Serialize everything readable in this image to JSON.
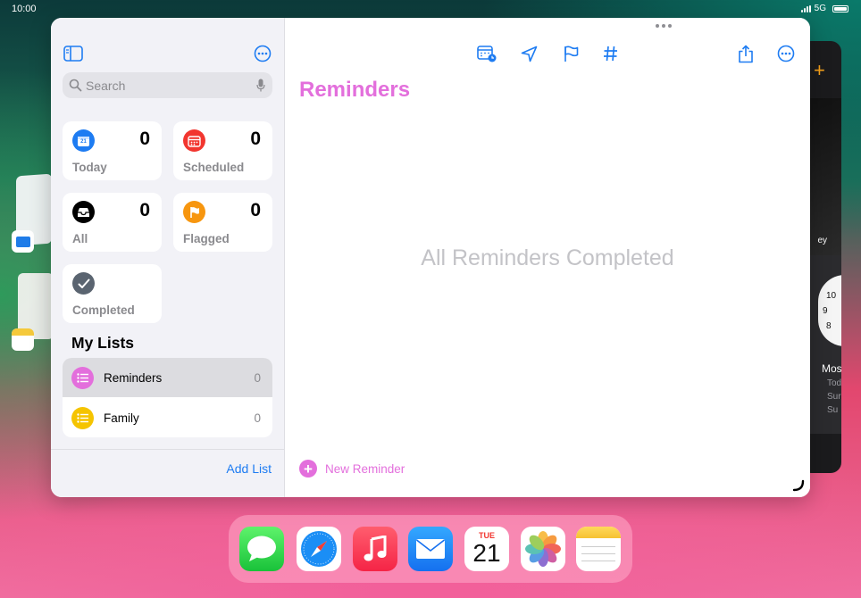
{
  "status_bar": {
    "time": "10:00",
    "network": "5G"
  },
  "sidebar": {
    "search": {
      "placeholder": "Search"
    },
    "smart_lists": [
      {
        "label": "Today",
        "count": "0",
        "color": "#1e7cf2",
        "icon": "calendar-today-icon",
        "day": "21"
      },
      {
        "label": "Scheduled",
        "count": "0",
        "color": "#f2362f",
        "icon": "calendar-icon"
      },
      {
        "label": "All",
        "count": "0",
        "color": "#000000",
        "icon": "tray-icon"
      },
      {
        "label": "Flagged",
        "count": "0",
        "color": "#f7960f",
        "icon": "flag-icon"
      },
      {
        "label": "Completed",
        "count": "",
        "color": "#5a6470",
        "icon": "checkmark-icon"
      }
    ],
    "my_lists_title": "My Lists",
    "lists": [
      {
        "name": "Reminders",
        "count": "0",
        "color": "#e36fdc",
        "selected": true
      },
      {
        "name": "Family",
        "count": "0",
        "color": "#f5c400",
        "selected": false
      }
    ],
    "add_list_label": "Add List"
  },
  "main": {
    "title": "Reminders",
    "title_color": "#e36fdc",
    "empty_message": "All Reminders Completed",
    "new_reminder_label": "New Reminder"
  },
  "dock": {
    "apps": [
      "messages",
      "safari",
      "music",
      "mail",
      "calendar",
      "photos",
      "notes"
    ],
    "calendar_dow": "TUE",
    "calendar_day": "21"
  },
  "background_app": {
    "label_fragment": "ey",
    "clock_numbers": [
      "10",
      "9",
      "8"
    ],
    "city": "Mos",
    "lines": [
      "Tod",
      "Sur",
      "Su"
    ]
  }
}
